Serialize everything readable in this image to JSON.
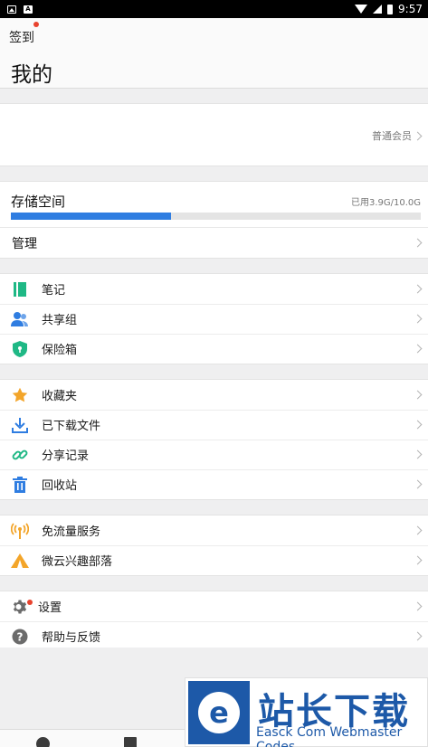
{
  "status_bar": {
    "time": "9:57"
  },
  "header": {
    "checkin_label": "签到",
    "title": "我的"
  },
  "profile": {
    "member_label": "普通会员"
  },
  "storage": {
    "title": "存储空间",
    "used_text": "已用3.9G/10.0G",
    "used_fraction": 0.39,
    "manage_label": "管理"
  },
  "groups": [
    [
      {
        "name": "notes",
        "label": "笔记",
        "icon": "notebook-icon",
        "color": "#1fb885"
      },
      {
        "name": "share-group",
        "label": "共享组",
        "icon": "people-icon",
        "color": "#2f7de1"
      },
      {
        "name": "safe-box",
        "label": "保险箱",
        "icon": "shield-icon",
        "color": "#1fb885"
      }
    ],
    [
      {
        "name": "favorites",
        "label": "收藏夹",
        "icon": "star-icon",
        "color": "#f3a52a"
      },
      {
        "name": "downloaded-files",
        "label": "已下载文件",
        "icon": "download-icon",
        "color": "#2f7de1"
      },
      {
        "name": "share-records",
        "label": "分享记录",
        "icon": "link-icon",
        "color": "#1fb885"
      },
      {
        "name": "recycle-bin",
        "label": "回收站",
        "icon": "trash-icon",
        "color": "#2f7de1"
      }
    ],
    [
      {
        "name": "free-traffic",
        "label": "免流量服务",
        "icon": "antenna-icon",
        "color": "#f3a52a"
      },
      {
        "name": "weiyun-tribe",
        "label": "微云兴趣部落",
        "icon": "tent-icon",
        "color": "#f3a52a"
      }
    ],
    [
      {
        "name": "settings",
        "label": "设置",
        "icon": "gear-icon",
        "color": "#6b6b6b"
      },
      {
        "name": "help-feedback",
        "label": "帮助与反馈",
        "icon": "help-icon",
        "color": "#6b6b6b"
      }
    ]
  ],
  "watermark": {
    "title": "站长下载",
    "subtitle": "Easck Com Webmaster Codes",
    "logo_letter": "e"
  },
  "colors": {
    "accent": "#2f7de1",
    "badge": "#e8432e"
  }
}
